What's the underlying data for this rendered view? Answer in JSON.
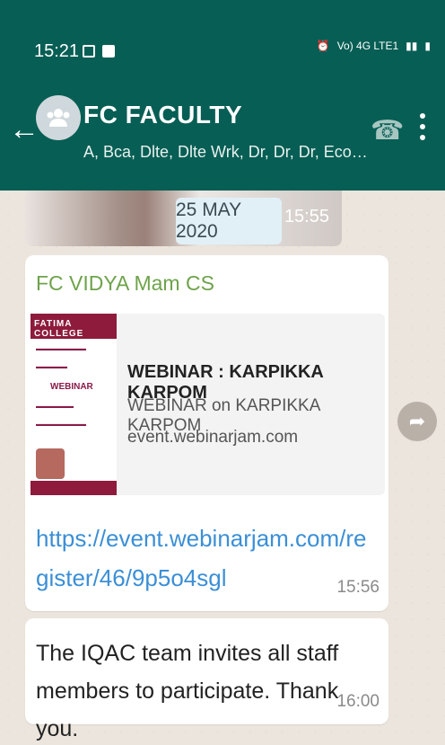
{
  "status": {
    "time": "15:21",
    "network": "Vo) 4G LTE1"
  },
  "header": {
    "title": "FC FACULTY",
    "subtitle": "A, Bca, Dlte, Dlte Wrk, Dr, Dr, Dr, Economics..."
  },
  "chat": {
    "previous_time": "15:55",
    "date_chip": "25 MAY 2020",
    "messages": [
      {
        "sender": "FC VIDYA Mam CS",
        "preview": {
          "title": "WEBINAR : KARPIKKA KARPOM",
          "description": "WEBINAR on KARPIKKA KARPOM",
          "domain": "event.webinarjam.com",
          "thumb_college": "FATIMA COLLEGE",
          "thumb_webinar": "WEBINAR"
        },
        "link": "https://event.webinarjam.com/register/46/9p5o4sgl",
        "time": "15:56"
      },
      {
        "text": "The IQAC team invites all staff members to participate. Thank you.",
        "time": "16:00"
      }
    ]
  },
  "colors": {
    "header": "#075e54",
    "sender": "#6ea34b",
    "link": "#3b8fd6"
  }
}
